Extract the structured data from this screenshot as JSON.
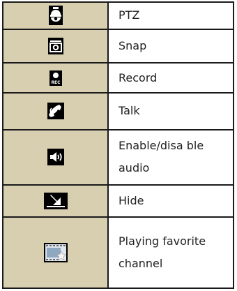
{
  "rows": [
    {
      "icon": "ptz-camera-icon",
      "label": "PTZ"
    },
    {
      "icon": "camera-snap-icon",
      "label": "Snap"
    },
    {
      "icon": "record-icon",
      "label": "Record",
      "icon_text": "REC"
    },
    {
      "icon": "phone-talk-icon",
      "label": "Talk"
    },
    {
      "icon": "speaker-audio-icon",
      "label": "Enable/disa ble audio"
    },
    {
      "icon": "hide-arrow-icon",
      "label": "Hide"
    },
    {
      "icon": "favorite-channel-icon",
      "label": "Playing favorite channel"
    }
  ],
  "colors": {
    "icon_cell_bg": "#d8ceb0",
    "icon_bg": "#000000",
    "border": "#1a1a1a"
  }
}
